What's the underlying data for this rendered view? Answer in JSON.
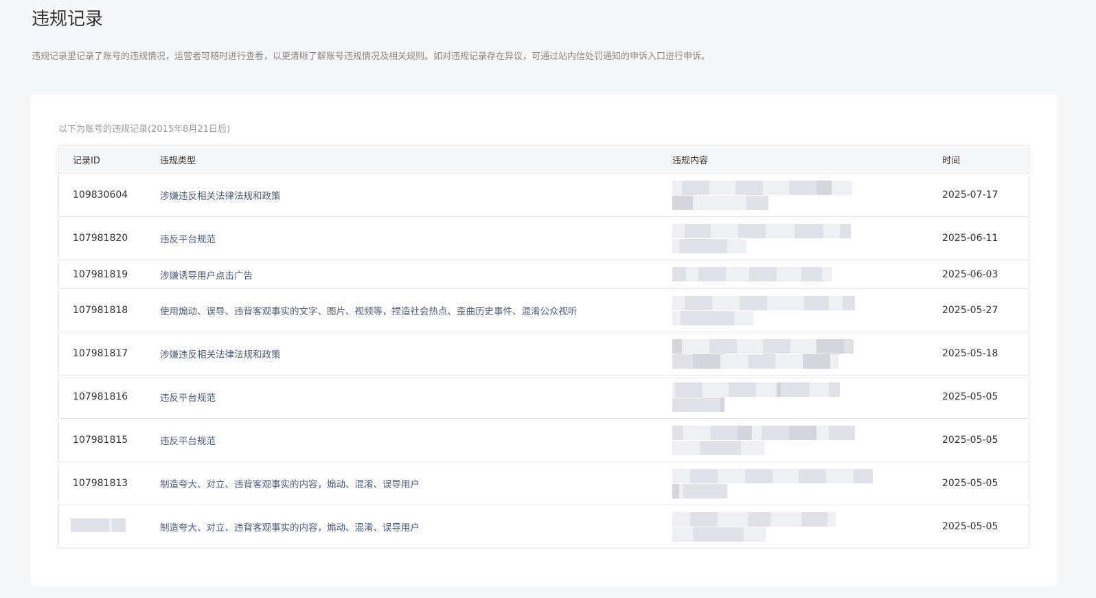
{
  "header": {
    "title": "违规记录",
    "description": "违规记录里记录了账号的违规情况，运营者可随时进行查看，以更清晰了解账号违规情况及相关规则。如对违规记录存在异议，可通过站内信处罚通知的申诉入口进行申诉。"
  },
  "records": {
    "caption": "以下为账号的违规记录(2015年8月21日后)",
    "columns": {
      "id": "记录ID",
      "type": "违规类型",
      "content": "违规内容",
      "time": "时间"
    },
    "rows": [
      {
        "id": "109830604",
        "type": "涉嫌违反相关法律法规和政策",
        "time": "2025-07-17"
      },
      {
        "id": "107981820",
        "type": "违反平台规范",
        "time": "2025-06-11"
      },
      {
        "id": "107981819",
        "type": "涉嫌诱导用户点击广告",
        "time": "2025-06-03"
      },
      {
        "id": "107981818",
        "type": "使用煽动、误导、违背客观事实的文字、图片、视频等，捏造社会热点、歪曲历史事件、混淆公众视听",
        "time": "2025-05-27"
      },
      {
        "id": "107981817",
        "type": "涉嫌违反相关法律法规和政策",
        "time": "2025-05-18"
      },
      {
        "id": "107981816",
        "type": "违反平台规范",
        "time": "2025-05-05"
      },
      {
        "id": "107981815",
        "type": "违反平台规范",
        "time": "2025-05-05"
      },
      {
        "id": "107981813",
        "type": "制造夸大、对立、违背客观事实的内容，煽动、混淆、误导用户",
        "time": "2025-05-05"
      },
      {
        "id": "",
        "type": "制造夸大、对立、违背客观事实的内容，煽动、混淆、误导用户",
        "time": "2025-05-05"
      }
    ]
  },
  "colors": {
    "page_background": "#f6f7f9",
    "card_background": "#ffffff",
    "type_text": "#4f5b79",
    "redacted_light": "#eef0f3",
    "redacted_mid": "#e0e2e8",
    "redacted_dark": "#d3d5db"
  }
}
